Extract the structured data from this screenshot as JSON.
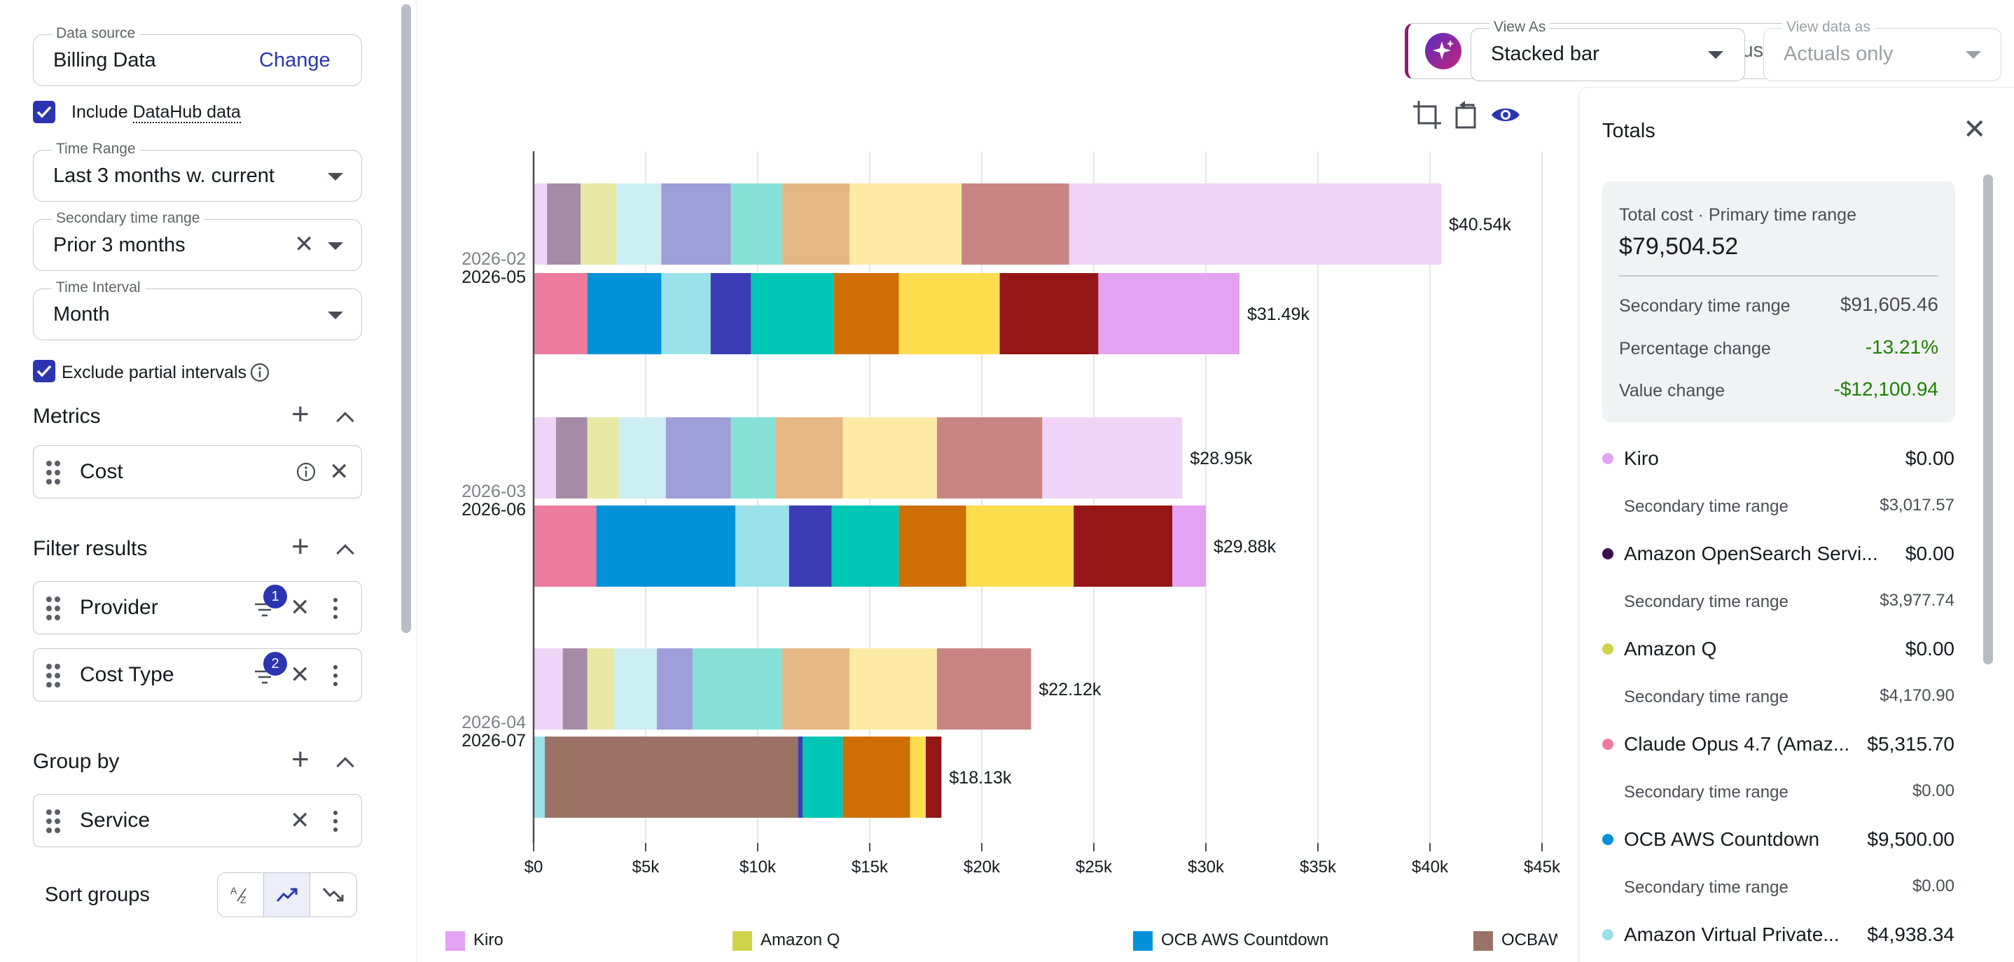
{
  "sidebar": {
    "data_source": {
      "label": "Data source",
      "value": "Billing Data",
      "change": "Change"
    },
    "include_datahub": {
      "label_prefix": "Include ",
      "label_link": "DataHub data",
      "checked": true
    },
    "time_range": {
      "label": "Time Range",
      "value": "Last 3 months w. current"
    },
    "secondary_time_range": {
      "label": "Secondary time range",
      "value": "Prior 3 months"
    },
    "time_interval": {
      "label": "Time Interval",
      "value": "Month"
    },
    "exclude_partial": {
      "label": "Exclude partial intervals",
      "checked": true
    },
    "metrics": {
      "title": "Metrics",
      "items": [
        "Cost"
      ]
    },
    "filter_results": {
      "title": "Filter results",
      "items": [
        {
          "label": "Provider",
          "badge": "1"
        },
        {
          "label": "Cost Type",
          "badge": "2"
        }
      ]
    },
    "group_by": {
      "title": "Group by",
      "items": [
        "Service"
      ]
    },
    "sort_groups": {
      "label": "Sort groups",
      "active": "ascending"
    }
  },
  "header": {
    "ai_placeholder": "Ask about spend, savings, or usage",
    "view_as": {
      "label": "View As",
      "value": "Stacked bar"
    },
    "view_data_as": {
      "label": "View data as",
      "value": "Actuals only",
      "disabled": true
    }
  },
  "chart_data": {
    "type": "bar",
    "orientation": "horizontal",
    "stacked": true,
    "xlim": [
      0,
      45000
    ],
    "x_ticks": [
      "$0",
      "$5k",
      "$10k",
      "$15k",
      "$20k",
      "$25k",
      "$30k",
      "$35k",
      "$40k",
      "$45k"
    ],
    "grid": true,
    "legend": "bottom",
    "groups": [
      {
        "primary_label": "2026-05",
        "secondary_label": "2026-02"
      },
      {
        "primary_label": "2026-06",
        "secondary_label": "2026-03"
      },
      {
        "primary_label": "2026-07",
        "secondary_label": "2026-04"
      }
    ],
    "bars": [
      {
        "period": "2026-02",
        "role": "secondary",
        "total_label": "$40.54k",
        "segments": [
          {
            "color": "#f0d4f7",
            "value": 600
          },
          {
            "color": "#a78aa6",
            "value": 1500
          },
          {
            "color": "#e8e8a4",
            "value": 1600
          },
          {
            "color": "#cdeef3",
            "value": 2000
          },
          {
            "color": "#9e9ed9",
            "value": 3100
          },
          {
            "color": "#86e0d8",
            "value": 2300
          },
          {
            "color": "#e5b784",
            "value": 3000
          },
          {
            "color": "#fdeaa5",
            "value": 5000
          },
          {
            "color": "#c98582",
            "value": 4800
          },
          {
            "color": "#f0d4f7",
            "value": 16600
          }
        ]
      },
      {
        "period": "2026-05",
        "role": "primary",
        "total_label": "$31.49k",
        "segments": [
          {
            "color": "#ed7b9d",
            "value": 2400
          },
          {
            "color": "#0091d9",
            "value": 3300
          },
          {
            "color": "#9ae1ea",
            "value": 2200
          },
          {
            "color": "#3b3db5",
            "value": 1800
          },
          {
            "color": "#00c6b5",
            "value": 3700
          },
          {
            "color": "#cf6f04",
            "value": 2900
          },
          {
            "color": "#fedd4e",
            "value": 4500
          },
          {
            "color": "#951616",
            "value": 4400
          },
          {
            "color": "#e3a2f2",
            "value": 6300
          }
        ]
      },
      {
        "period": "2026-03",
        "role": "secondary",
        "total_label": "$28.95k",
        "segments": [
          {
            "color": "#f0d4f7",
            "value": 1000
          },
          {
            "color": "#a78aa6",
            "value": 1400
          },
          {
            "color": "#e8e8a4",
            "value": 1400
          },
          {
            "color": "#cdeef3",
            "value": 2100
          },
          {
            "color": "#9e9ed9",
            "value": 2900
          },
          {
            "color": "#86e0d8",
            "value": 2000
          },
          {
            "color": "#e5b784",
            "value": 3000
          },
          {
            "color": "#fdeaa5",
            "value": 4200
          },
          {
            "color": "#c98582",
            "value": 4700
          },
          {
            "color": "#f0d4f7",
            "value": 6250
          }
        ]
      },
      {
        "period": "2026-06",
        "role": "primary",
        "total_label": "$29.88k",
        "segments": [
          {
            "color": "#ed7b9d",
            "value": 2800
          },
          {
            "color": "#0091d9",
            "value": 6200
          },
          {
            "color": "#9ae1ea",
            "value": 2400
          },
          {
            "color": "#3b3db5",
            "value": 1900
          },
          {
            "color": "#00c6b5",
            "value": 3000
          },
          {
            "color": "#cf6f04",
            "value": 3000
          },
          {
            "color": "#fedd4e",
            "value": 4800
          },
          {
            "color": "#951616",
            "value": 4400
          },
          {
            "color": "#e3a2f2",
            "value": 1500
          }
        ]
      },
      {
        "period": "2026-04",
        "role": "secondary",
        "total_label": "$22.12k",
        "segments": [
          {
            "color": "#f0d4f7",
            "value": 1300
          },
          {
            "color": "#a78aa6",
            "value": 1100
          },
          {
            "color": "#e8e8a4",
            "value": 1200
          },
          {
            "color": "#cdeef3",
            "value": 1900
          },
          {
            "color": "#9e9ed9",
            "value": 1600
          },
          {
            "color": "#86e0d8",
            "value": 4000
          },
          {
            "color": "#e5b784",
            "value": 3000
          },
          {
            "color": "#fdeaa5",
            "value": 3900
          },
          {
            "color": "#c98582",
            "value": 4200
          }
        ]
      },
      {
        "period": "2026-07",
        "role": "primary",
        "total_label": "$18.13k",
        "segments": [
          {
            "color": "#9ae1ea",
            "value": 500
          },
          {
            "color": "#9a7366",
            "value": 11300
          },
          {
            "color": "#3b3db5",
            "value": 200
          },
          {
            "color": "#00c6b5",
            "value": 1800
          },
          {
            "color": "#cf6f04",
            "value": 3000
          },
          {
            "color": "#fedd4e",
            "value": 700
          },
          {
            "color": "#951616",
            "value": 700
          }
        ]
      }
    ],
    "legend_items": [
      {
        "name": "Kiro",
        "color": "#e3a2f2"
      },
      {
        "name": "Amazon Q",
        "color": "#cfd24b"
      },
      {
        "name": "OCB AWS Countdown",
        "color": "#0091d9"
      },
      {
        "name": "OCBAW",
        "color": "#9a7366"
      }
    ]
  },
  "totals": {
    "title": "Totals",
    "summary": {
      "caption": "Total cost · Primary time range",
      "total": "$79,504.52",
      "rows": [
        {
          "label": "Secondary time range",
          "value": "$91,605.46",
          "color": "#16191f"
        },
        {
          "label": "Percentage change",
          "value": "-13.21%",
          "color": "#1d8102"
        },
        {
          "label": "Value change",
          "value": "-$12,100.94",
          "color": "#1d8102"
        }
      ]
    },
    "services": [
      {
        "name": "Kiro",
        "value": "$0.00",
        "secondary_label": "Secondary time range",
        "secondary_value": "$3,017.57",
        "color": "#e3a2f2"
      },
      {
        "name": "Amazon OpenSearch Servi...",
        "value": "$0.00",
        "secondary_label": "Secondary time range",
        "secondary_value": "$3,977.74",
        "color": "#3d0c4f"
      },
      {
        "name": "Amazon Q",
        "value": "$0.00",
        "secondary_label": "Secondary time range",
        "secondary_value": "$4,170.90",
        "color": "#cfd24b"
      },
      {
        "name": "Claude Opus 4.7 (Amaz...",
        "value": "$5,315.70",
        "secondary_label": "Secondary time range",
        "secondary_value": "$0.00",
        "color": "#ed7b9d"
      },
      {
        "name": "OCB AWS Countdown",
        "value": "$9,500.00",
        "secondary_label": "Secondary time range",
        "secondary_value": "$0.00",
        "color": "#0091d9"
      },
      {
        "name": "Amazon Virtual Private...",
        "value": "$4,938.34",
        "secondary_label": "",
        "secondary_value": "",
        "color": "#9ae1ea"
      }
    ]
  }
}
